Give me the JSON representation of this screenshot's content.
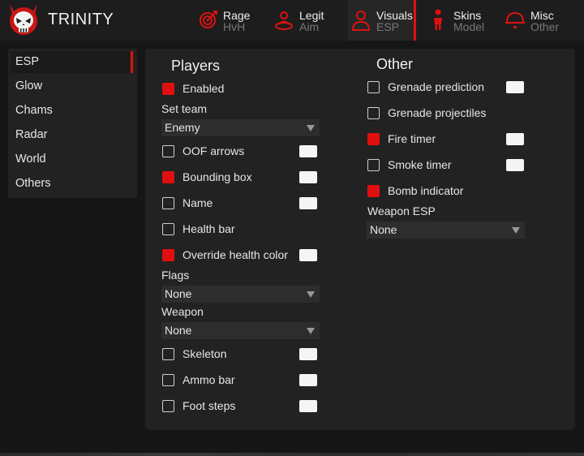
{
  "app": {
    "brand": "TRINITY"
  },
  "tabs": [
    {
      "id": "rage",
      "label": "Rage",
      "sub": "HvH",
      "icon": "target-icon"
    },
    {
      "id": "legit",
      "label": "Legit",
      "sub": "Aim",
      "icon": "person-target-icon"
    },
    {
      "id": "visuals",
      "label": "Visuals",
      "sub": "ESP",
      "icon": "person-icon",
      "active": true
    },
    {
      "id": "skins",
      "label": "Skins",
      "sub": "Model",
      "icon": "figure-icon"
    },
    {
      "id": "misc",
      "label": "Misc",
      "sub": "Other",
      "icon": "alarm-bell-icon"
    }
  ],
  "sidebar": {
    "items": [
      {
        "label": "ESP",
        "active": true
      },
      {
        "label": "Glow"
      },
      {
        "label": "Chams"
      },
      {
        "label": "Radar"
      },
      {
        "label": "World"
      },
      {
        "label": "Others"
      }
    ]
  },
  "players": {
    "heading": "Players",
    "enabled": {
      "label": "Enabled",
      "checked": true
    },
    "set_team": {
      "label": "Set team",
      "value": "Enemy"
    },
    "oof_arrows": {
      "label": "OOF arrows",
      "checked": false
    },
    "bounding_box": {
      "label": "Bounding box",
      "checked": true
    },
    "name": {
      "label": "Name",
      "checked": false
    },
    "health_bar": {
      "label": "Health bar",
      "checked": false
    },
    "override_health_color": {
      "label": "Override health color",
      "checked": true
    },
    "flags": {
      "label": "Flags",
      "value": "None"
    },
    "weapon": {
      "label": "Weapon",
      "value": "None"
    },
    "skeleton": {
      "label": "Skeleton",
      "checked": false
    },
    "ammo_bar": {
      "label": "Ammo bar",
      "checked": false
    },
    "foot_steps": {
      "label": "Foot steps",
      "checked": false
    }
  },
  "other": {
    "heading": "Other",
    "grenade_prediction": {
      "label": "Grenade prediction",
      "checked": false
    },
    "grenade_projectiles": {
      "label": "Grenade projectiles",
      "checked": false
    },
    "fire_timer": {
      "label": "Fire timer",
      "checked": true
    },
    "smoke_timer": {
      "label": "Smoke timer",
      "checked": false
    },
    "bomb_indicator": {
      "label": "Bomb indicator",
      "checked": true
    },
    "weapon_esp": {
      "label": "Weapon ESP",
      "value": "None"
    }
  },
  "colors": {
    "accent": "#e01010",
    "background": "#161616",
    "panel": "#222222",
    "swatch": "#f5f5f5"
  }
}
